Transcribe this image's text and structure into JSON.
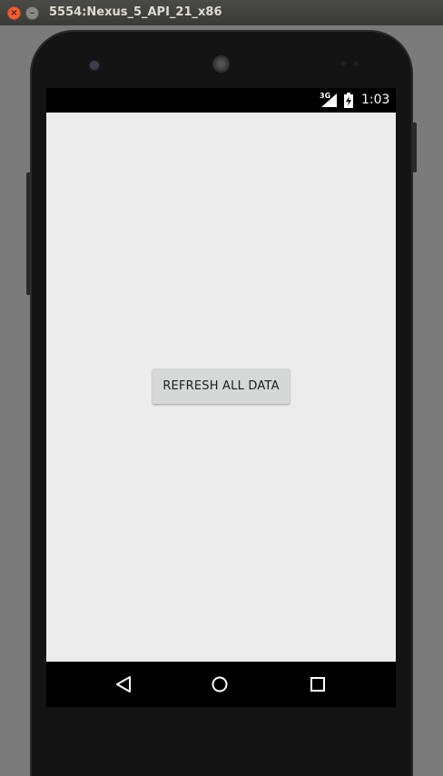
{
  "window": {
    "title": "5554:Nexus_5_API_21_x86",
    "close_icon": "close-icon",
    "minimize_icon": "minimize-icon"
  },
  "status_bar": {
    "network_type": "3G",
    "time": "1:03",
    "signal_icon": "cellular-signal-icon",
    "battery_icon": "battery-charging-icon"
  },
  "main": {
    "refresh_button_label": "REFRESH ALL DATA"
  },
  "nav_bar": {
    "back_icon": "back-triangle-icon",
    "home_icon": "home-circle-icon",
    "recents_icon": "recents-square-icon"
  },
  "colors": {
    "screen_background": "#ececec",
    "button_background": "#d6d7d7",
    "bezel": "#141414",
    "desktop": "#7b7b7b"
  }
}
